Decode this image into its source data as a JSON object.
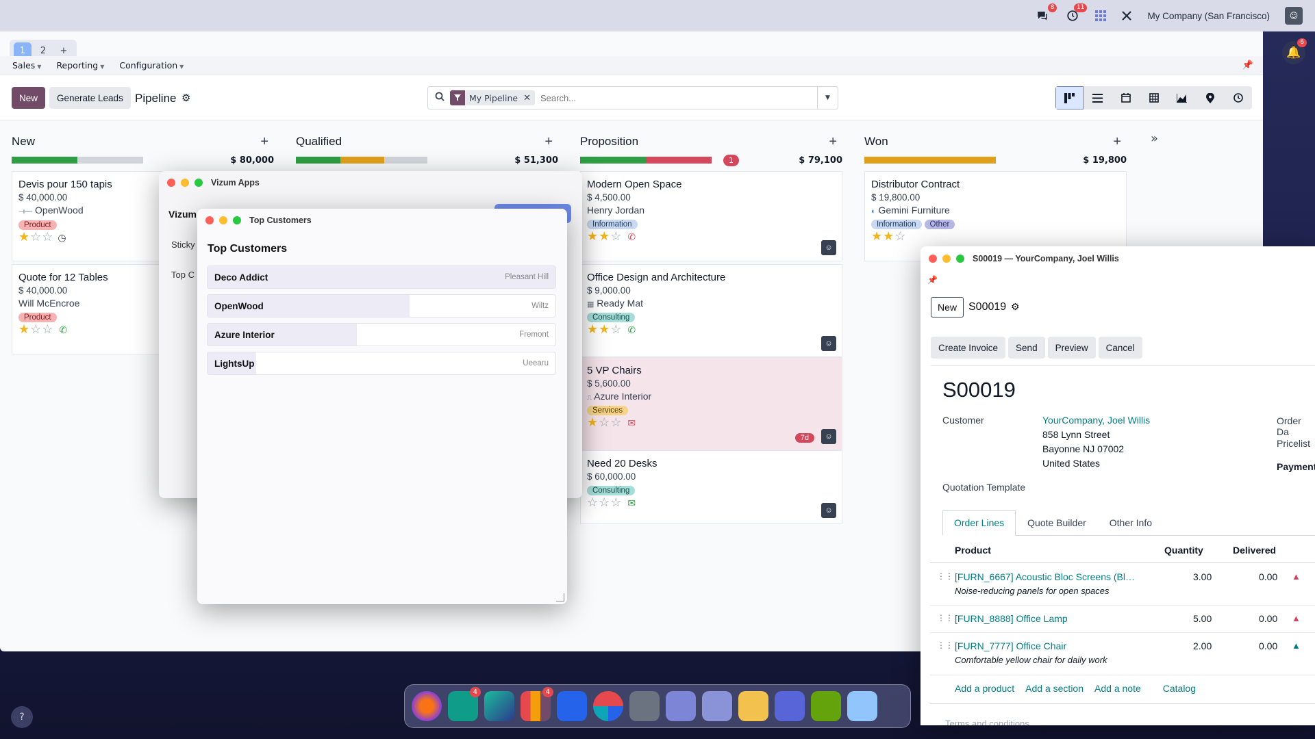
{
  "topbar": {
    "chat_badge": "8",
    "activity_badge": "11",
    "company": "My Company (San Francisco)",
    "notif_badge": "6"
  },
  "window_tabs": [
    "1",
    "2",
    "+"
  ],
  "menu": [
    "Sales",
    "Reporting",
    "Configuration"
  ],
  "control": {
    "new_label": "New",
    "generate_label": "Generate Leads",
    "breadcrumb": "Pipeline",
    "facet": "My Pipeline",
    "search_placeholder": "Search..."
  },
  "columns": [
    {
      "title": "New",
      "total": "$ 80,000",
      "progress": [
        {
          "color": "#2f9e44",
          "fraction": 0.5
        }
      ]
    },
    {
      "title": "Qualified",
      "total": "$ 51,300",
      "progress": [
        {
          "color": "#2f9e44",
          "fraction": 0.34
        },
        {
          "color": "#e0a01b",
          "fraction": 0.33
        }
      ]
    },
    {
      "title": "Proposition",
      "total": "$ 79,100",
      "badge": "1",
      "progress": [
        {
          "color": "#2f9e44",
          "fraction": 0.5
        },
        {
          "color": "#d4485e",
          "fraction": 0.5
        }
      ]
    },
    {
      "title": "Won",
      "total": "$ 19,800",
      "progress": [
        {
          "color": "#e0a01b",
          "fraction": 1.0
        }
      ]
    }
  ],
  "cards": {
    "new1": {
      "title": "Devis pour 150 tapis",
      "amount": "$ 40,000.00",
      "customer": "OpenWood",
      "tag": "Product",
      "stars": 1
    },
    "new2": {
      "title": "Quote for 12 Tables",
      "amount": "$ 40,000.00",
      "customer": "Will McEncroe",
      "tag": "Product",
      "stars": 1
    },
    "prop1": {
      "title": "Modern Open Space",
      "amount": "$ 4,500.00",
      "customer": "Henry Jordan",
      "tag": "Information",
      "stars": 2
    },
    "prop2": {
      "title": "Office Design and Architecture",
      "amount": "$ 9,000.00",
      "customer": "Ready Mat",
      "tag": "Consulting",
      "stars": 2
    },
    "prop3": {
      "title": "5 VP Chairs",
      "amount": "$ 5,600.00",
      "customer": "Azure Interior",
      "tag": "Services",
      "stars": 1,
      "overdue": "7d"
    },
    "prop4": {
      "title": "Need 20 Desks",
      "amount": "$ 60,000.00",
      "tag": "Consulting",
      "stars": 0
    },
    "won1": {
      "title": "Distributor Contract",
      "amount": "$ 19,800.00",
      "customer": "Gemini Furniture",
      "tag1": "Information",
      "tag2": "Other",
      "stars": 2
    }
  },
  "vizum": {
    "window_title": "Vizum Apps",
    "heading": "Vizum",
    "item1": "Sticky",
    "item2": "Top C"
  },
  "top_customers": {
    "window_title": "Top Customers",
    "heading": "Top Customers",
    "rows": [
      {
        "name": "Deco Addict",
        "city": "Pleasant Hill",
        "share": 1.0
      },
      {
        "name": "OpenWood",
        "city": "Wiltz",
        "share": 0.58
      },
      {
        "name": "Azure Interior",
        "city": "Fremont",
        "share": 0.43
      },
      {
        "name": "LightsUp",
        "city": "Ueearu",
        "share": 0.14
      }
    ]
  },
  "order": {
    "window_title": "S00019 — YourCompany, Joel Willis",
    "new_label": "New",
    "breadcrumb": "S00019",
    "actions": [
      "Create Invoice",
      "Send",
      "Preview",
      "Cancel"
    ],
    "name": "S00019",
    "customer_label": "Customer",
    "customer_name": "YourCompany, Joel Willis",
    "address": [
      "858 Lynn Street",
      "Bayonne NJ 07002",
      "United States"
    ],
    "order_date_label": "Order Da",
    "pricelist_label": "Pricelist",
    "payment_label": "Payment",
    "template_label": "Quotation Template",
    "tabs": [
      "Order Lines",
      "Quote Builder",
      "Other Info"
    ],
    "headers": {
      "product": "Product",
      "quantity": "Quantity",
      "delivered": "Delivered"
    },
    "lines": [
      {
        "product": "[FURN_6667] Acoustic Bloc Screens (Bl…",
        "desc": "Noise-reducing panels for open spaces",
        "qty": "3.00",
        "delivered": "0.00"
      },
      {
        "product": "[FURN_8888] Office Lamp",
        "desc": "",
        "qty": "5.00",
        "delivered": "0.00"
      },
      {
        "product": "[FURN_7777] Office Chair",
        "desc": "Comfortable yellow chair for daily work",
        "qty": "2.00",
        "delivered": "0.00"
      }
    ],
    "add_links": [
      "Add a product",
      "Add a section",
      "Add a note",
      "Catalog"
    ],
    "terms": "Terms and conditions"
  },
  "dock": {
    "badges": [
      "4",
      "4"
    ]
  },
  "help": "?"
}
